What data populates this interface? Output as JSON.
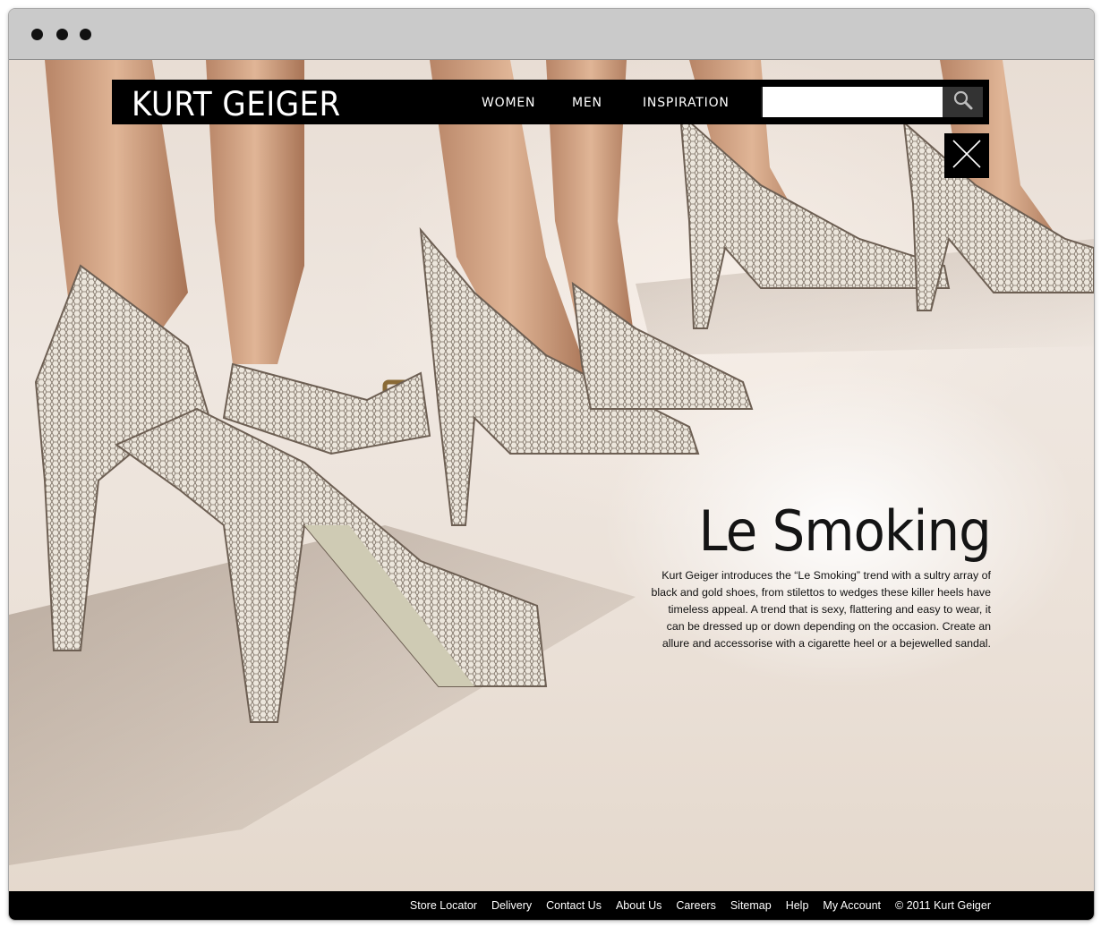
{
  "window": {
    "controls": [
      "close-dot",
      "minimize-dot",
      "zoom-dot"
    ]
  },
  "header": {
    "logo": "KURT GEIGER",
    "nav": [
      {
        "label": "WOMEN"
      },
      {
        "label": "MEN"
      },
      {
        "label": "INSPIRATION"
      }
    ],
    "search": {
      "value": "",
      "placeholder": "",
      "button_icon": "search-icon"
    },
    "close_icon": "close-icon"
  },
  "hero": {
    "title": "Le Smoking",
    "text": "Kurt Geiger introduces the “Le Smoking” trend with a sultry array of black and gold shoes, from stilettos to wedges these killer heels have timeless appeal. A trend that is sexy, flattering and easy to wear, it can be dressed up or down depending on the occasion. Create an allure and accessorise with a cigarette heel or a bejewelled sandal.",
    "image": "snakeskin-heels-photo"
  },
  "footer": {
    "links": [
      {
        "label": "Store Locator"
      },
      {
        "label": "Delivery"
      },
      {
        "label": "Contact Us"
      },
      {
        "label": "About Us"
      },
      {
        "label": "Careers"
      },
      {
        "label": "Sitemap"
      },
      {
        "label": "Help"
      },
      {
        "label": "My Account"
      }
    ],
    "copyright": "© 2011 Kurt Geiger"
  },
  "colors": {
    "nav_bg": "#000000",
    "chrome_bg": "#cacaca",
    "text_dark": "#141414"
  }
}
